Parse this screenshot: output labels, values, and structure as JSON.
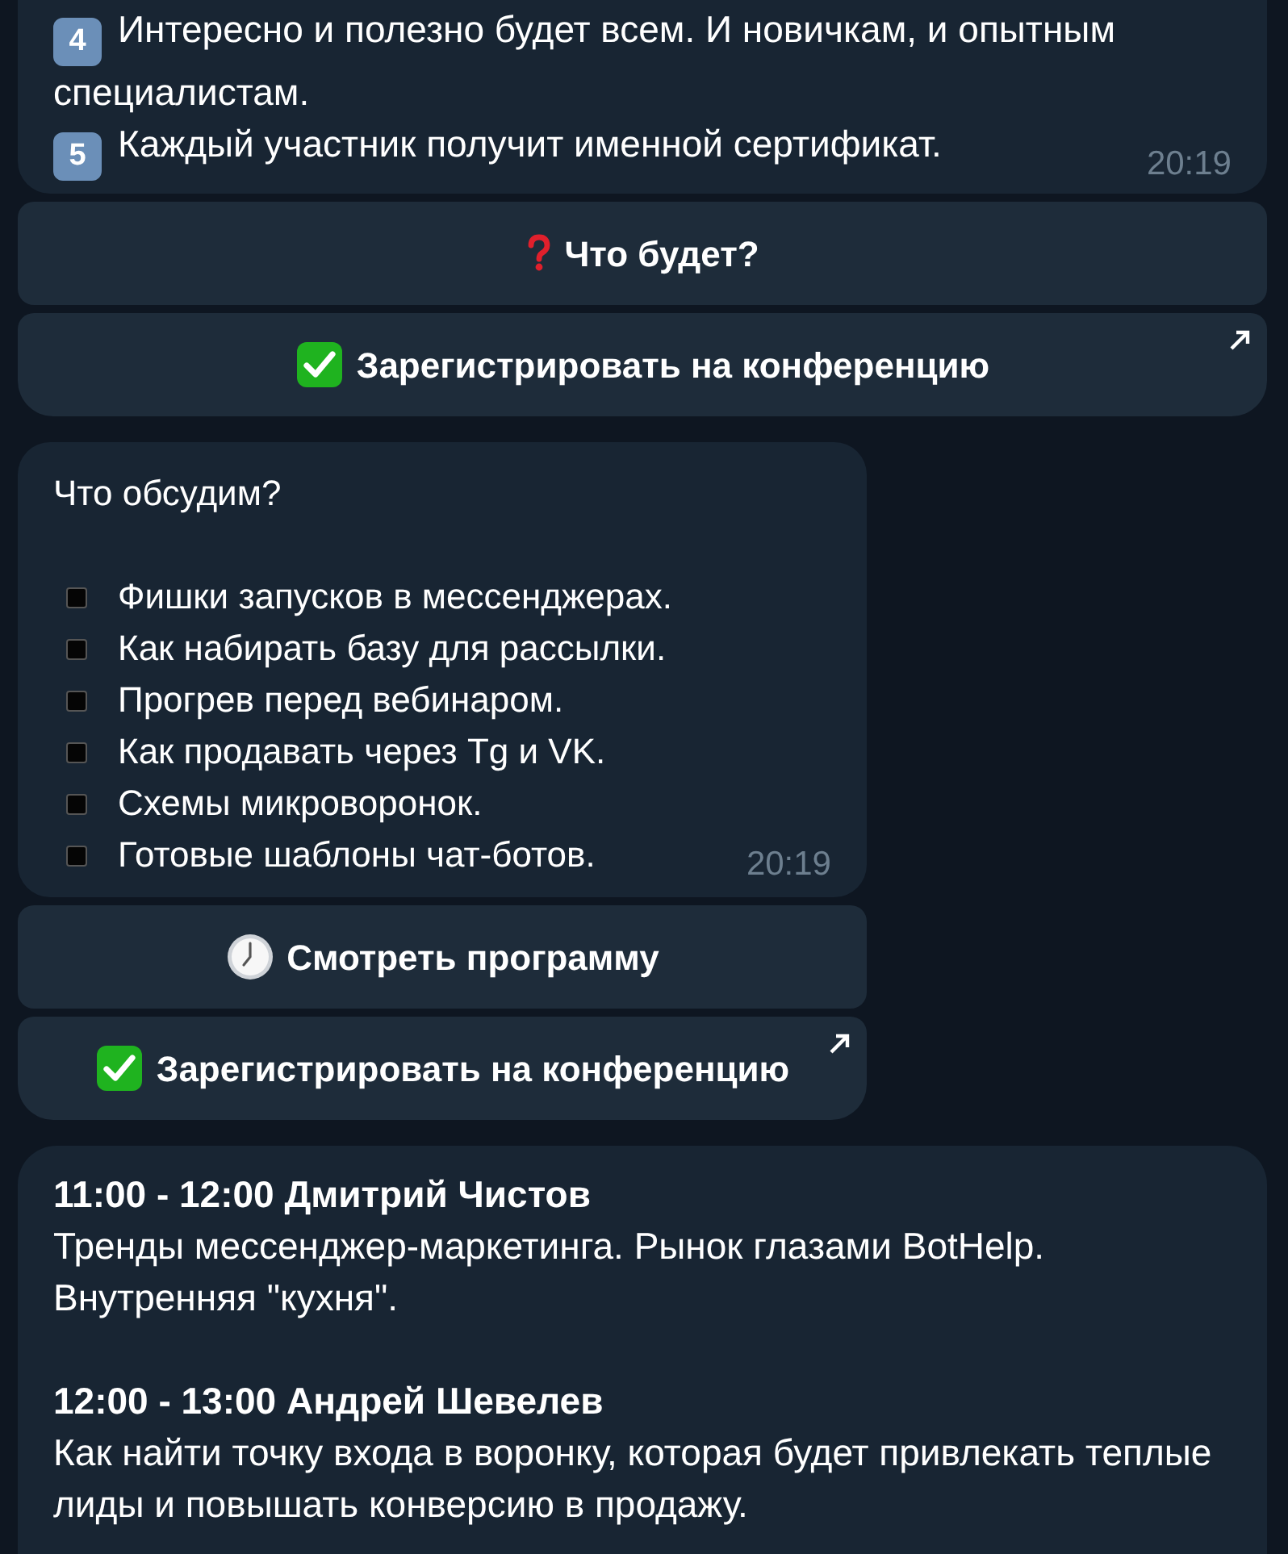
{
  "messages": [
    {
      "kind": "numbered",
      "items": [
        {
          "number": "4",
          "text": "Интересно и полезно будет всем. И новичкам, и опытным специалистам."
        },
        {
          "number": "5",
          "text": "Каждый участник получит именной сертификат."
        }
      ],
      "time": "20:19",
      "buttons": [
        {
          "kind": "question",
          "label": "Что будет?",
          "external": false
        },
        {
          "kind": "check",
          "label": "Зарегистрировать на конференцию",
          "external": true
        }
      ]
    },
    {
      "kind": "bulleted",
      "title": "Что обсудим?",
      "items": [
        "Фишки запусков в мессенджерах.",
        "Как набирать базу для рассылки.",
        "Прогрев перед вебинаром.",
        "Как продавать через Tg и VK.",
        "Схемы микроворонок.",
        "Готовые шаблоны чат-ботов."
      ],
      "time": "20:19",
      "buttons": [
        {
          "kind": "clock",
          "label": "Смотреть программу",
          "external": false
        },
        {
          "kind": "check",
          "label": "Зарегистрировать на конференцию",
          "external": true
        }
      ]
    },
    {
      "kind": "schedule",
      "sessions": [
        {
          "heading": "11:00 - 12:00 Дмитрий Чистов",
          "description": "Тренды мессенджер-маркетинга. Рынок глазами BotHelp. Внутренняя \"кухня\"."
        },
        {
          "heading": "12:00 - 13:00 Андрей Шевелев",
          "description": "Как найти точку входа в воронку, которая будет привлекать теплые лиды и повышать конверсию в продажу."
        }
      ]
    }
  ]
}
